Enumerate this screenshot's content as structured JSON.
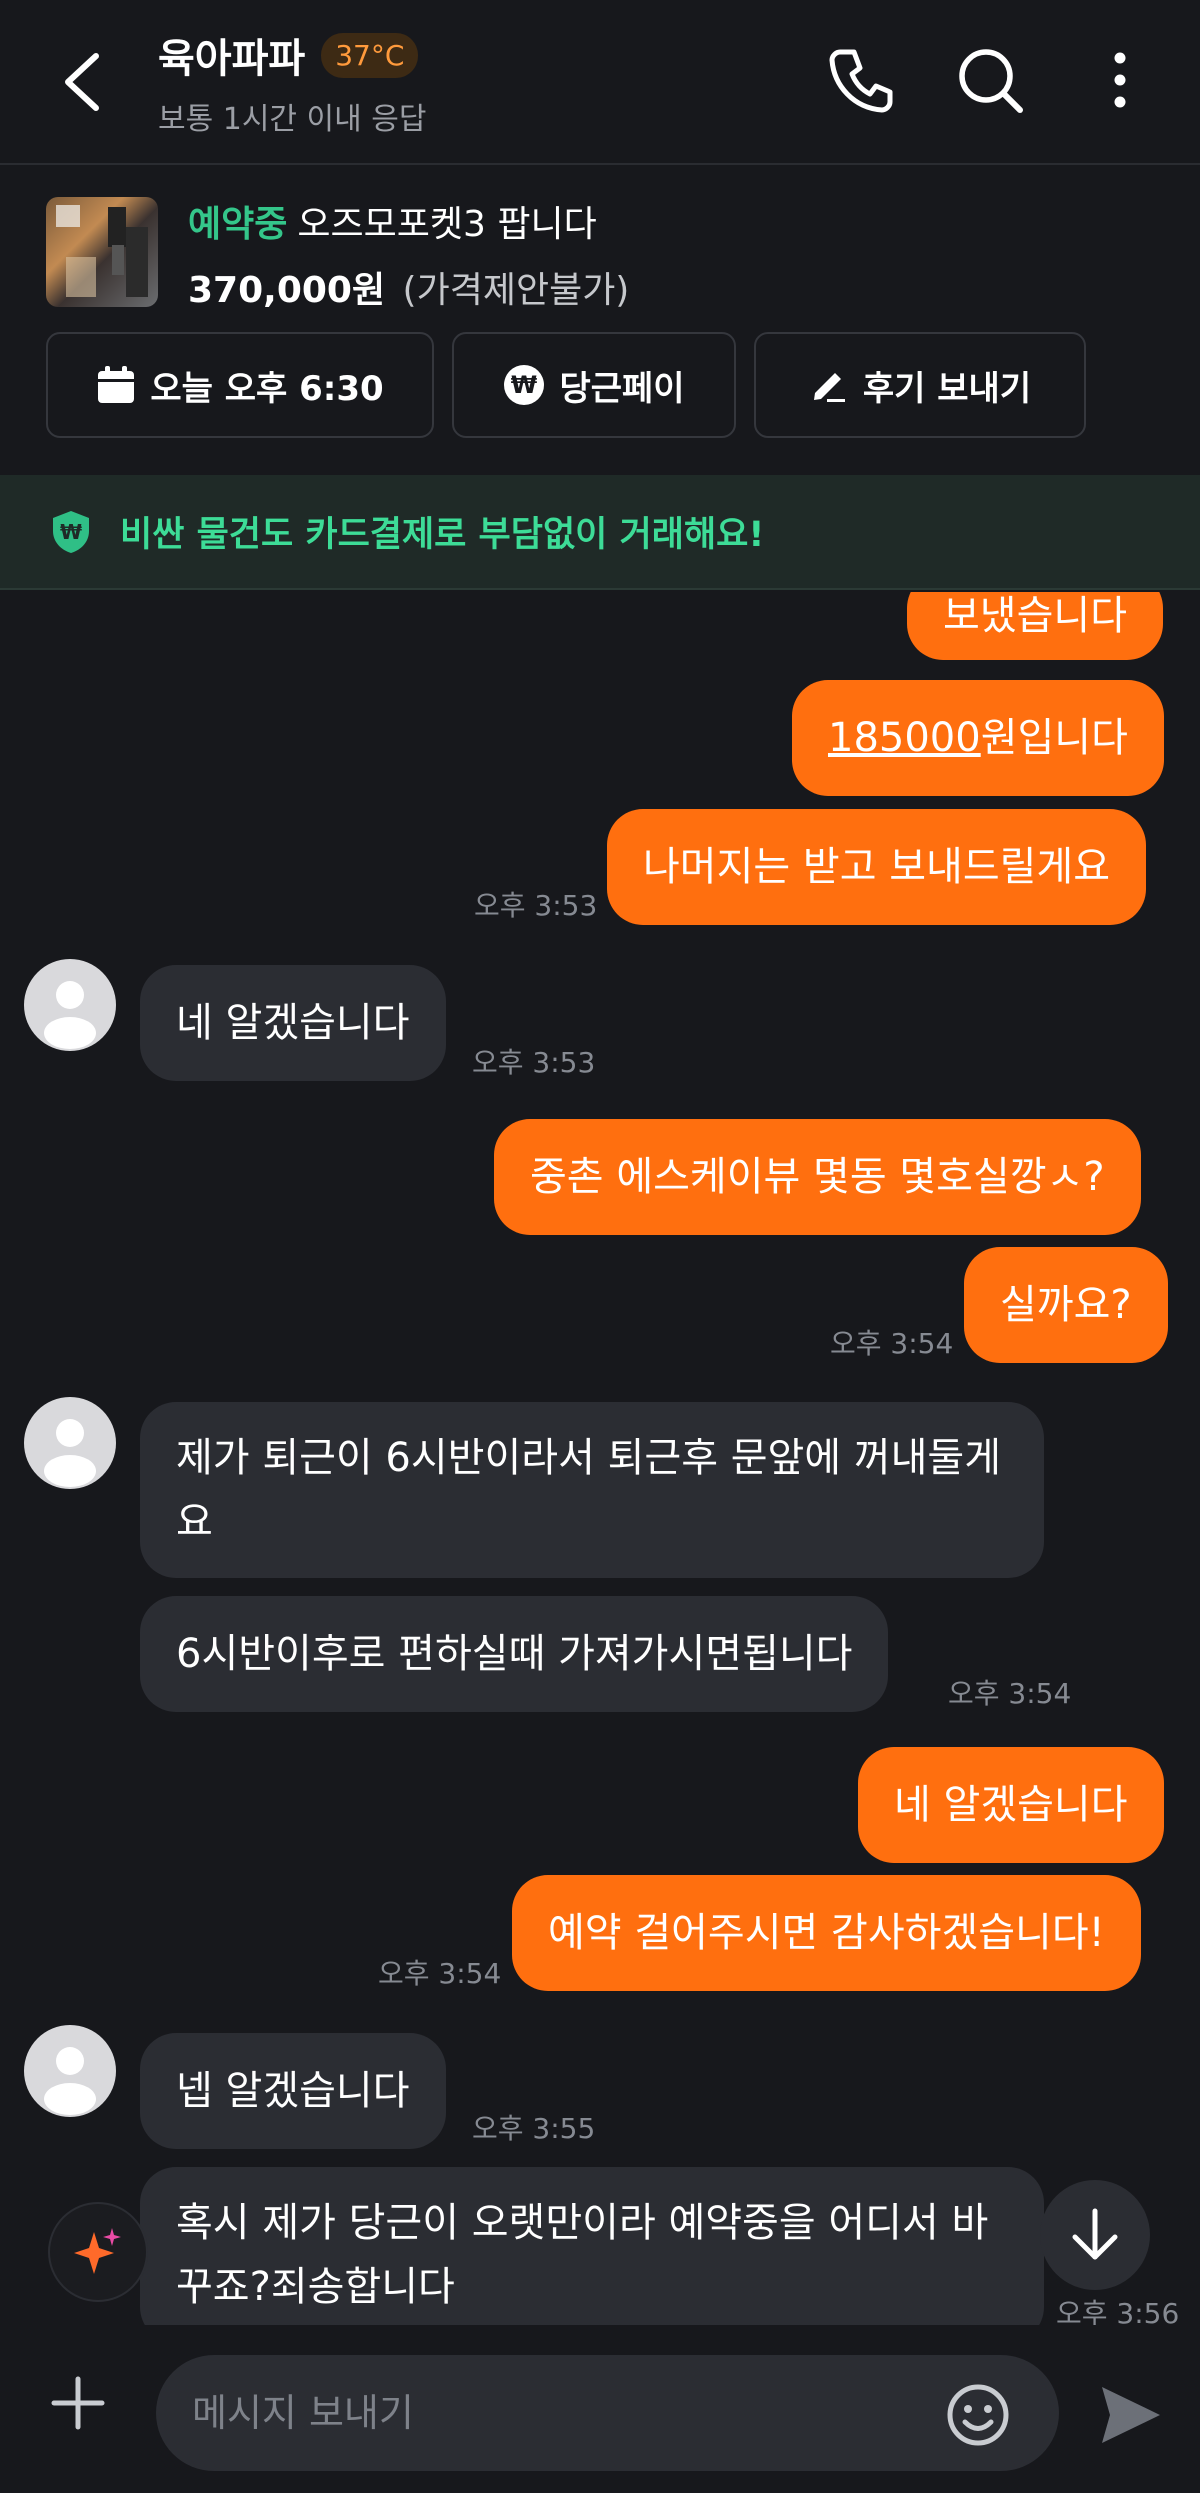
{
  "header": {
    "title": "육아파파",
    "temperature": "37°C",
    "subtitle": "보통 1시간 이내 응답"
  },
  "product": {
    "status": "예약중",
    "name": "오즈모포켓3 팝니다",
    "price": "370,000원",
    "price_note": "(가격제안불가)",
    "actions": {
      "appointment": "오늘 오후 6:30",
      "pay": "당근페이",
      "review": "후기 보내기"
    }
  },
  "banner": {
    "text": "비싼 물건도 카드결제로 부담없이 거래해요!"
  },
  "messages": {
    "m0": "보냈습니다",
    "m1_link": "185000",
    "m1_rest": "원입니다",
    "m2": "나머지는 받고 보내드릴게요",
    "t2": "오후 3:53",
    "m3": "네 알겠습니다",
    "t3": "오후 3:53",
    "m4": "중촌 에스케이뷰 몇동 몇호실깡ㅅ?",
    "m5": "실까요?",
    "t5": "오후 3:54",
    "m6": "제가 퇴근이 6시반이라서 퇴근후 문앞에 꺼내둘게요",
    "m7": "6시반이후로 편하실때 가져가시면됩니다",
    "t7": "오후 3:54",
    "m8": "네 알겠습니다",
    "m9": "예약 걸어주시면 감사하겠습니다!",
    "t9": "오후 3:54",
    "m10": "넵 알겠습니다",
    "t10": "오후 3:55",
    "m11": "혹시 제가 당근이 오랫만이라 예약중을 어디서 바꾸죠?죄송합니다",
    "t11": "오후 3:56"
  },
  "composer": {
    "placeholder": "메시지 보내기"
  },
  "colors": {
    "background": "#17181c",
    "outgoing_bubble": "#ff6f0f",
    "incoming_bubble": "#2b2d33",
    "reserved_status": "#34c68a",
    "banner_text": "#3ddc97",
    "temperature": "#ff9a3c"
  }
}
